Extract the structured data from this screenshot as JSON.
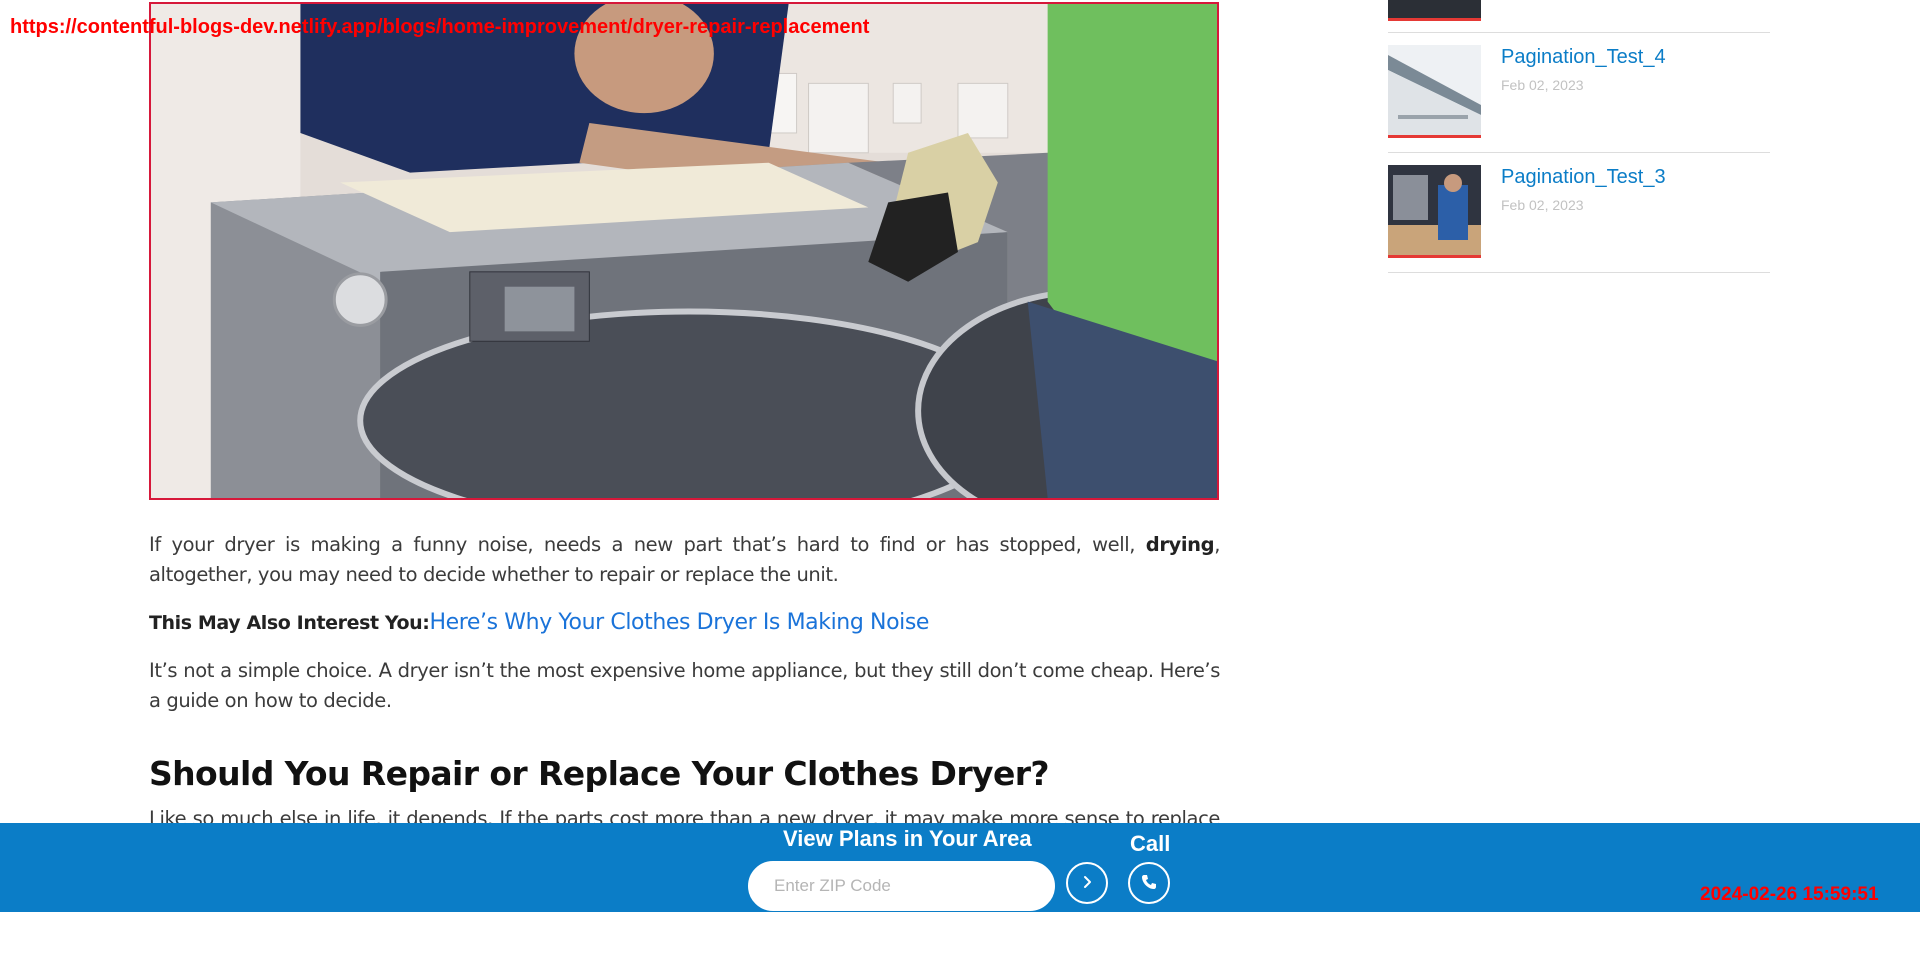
{
  "overlay": {
    "url": "https://contentful-blogs-dev.netlify.app/blogs/home-improvement/dryer-repair-replacement",
    "timestamp": "2024-02-26 15:59:51"
  },
  "article": {
    "intro_before": "If your dryer is making a funny noise, needs a new part that’s hard to find or has stopped, well, ",
    "intro_bold": "drying",
    "intro_after": ", altogether, you may need to decide whether to repair or replace the unit.",
    "interest_label": "This May Also Interest You:",
    "interest_link": "Here’s Why Your Clothes Dryer Is Making Noise",
    "para2": "It’s not a simple choice. A dryer isn’t the most expensive home appliance, but they still don’t come cheap. Here’s a guide on how to decide.",
    "heading": "Should You Repair or Replace Your Clothes Dryer?",
    "para3": "Like so much else in life, it depends. If the parts cost more than a new dryer, it may make more sense to replace it."
  },
  "sidebar": {
    "items": [
      {
        "title": "Pagination_Test_4",
        "date": "Feb 02, 2023"
      },
      {
        "title": "Pagination_Test_3",
        "date": "Feb 02, 2023"
      }
    ]
  },
  "footer": {
    "plans_title": "View Plans in Your Area",
    "zip_placeholder": "Enter ZIP Code",
    "call_label": "Call"
  },
  "colors": {
    "brand_blue": "#0b7dc7",
    "link_blue": "#1a73d9",
    "accent_red": "#e53935"
  }
}
